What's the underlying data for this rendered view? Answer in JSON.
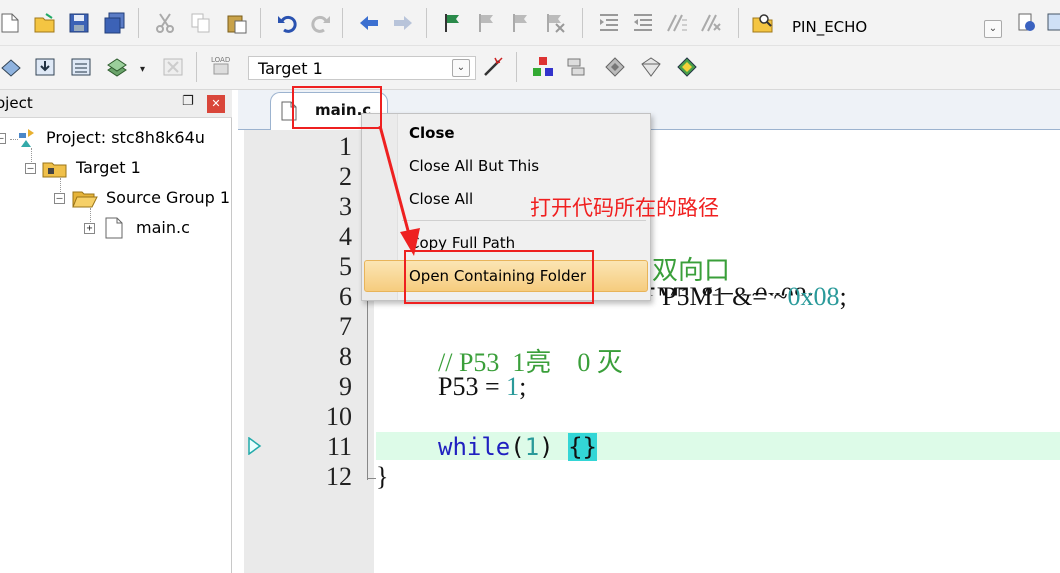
{
  "toolbar1": {
    "config_name": "PIN_ECHO"
  },
  "toolbar2": {
    "target_name": "Target 1"
  },
  "project_panel": {
    "title": "oject",
    "pin_glyph": "❐",
    "close_glyph": "✕",
    "tree": {
      "project": "Project: stc8h8k64u",
      "target": "Target 1",
      "group": "Source Group 1",
      "file": "main.c"
    }
  },
  "editor": {
    "tab_label": "main.c",
    "line_numbers": [
      "1",
      "2",
      "3",
      "4",
      "5",
      "6",
      "7",
      "8",
      "9",
      "10",
      "11",
      "12"
    ],
    "code": {
      "line5_tail": "双向口",
      "line6_visible": "P5M0 &= ~0x08; P5M1 &= ~0x08;",
      "line6_p5m1": "P5M1 &= ",
      "line6_tilde": "~",
      "line6_hex": "0x08",
      "line6_semi": ";",
      "line8_comment": "// P53  1亮    0 灭",
      "line9_lhs": "P53 = ",
      "line9_val": "1",
      "line9_semi": ";",
      "line11_kw": "while",
      "line11_open": "(",
      "line11_num": "1",
      "line11_close": ") ",
      "line11_brace": "{}",
      "line12_brace": "}"
    }
  },
  "context_menu": {
    "items": [
      {
        "label": "Close"
      },
      {
        "label": "Close All But This"
      },
      {
        "label": "Close All"
      },
      {
        "label": "Copy Full Path"
      },
      {
        "label": "Open Containing Folder"
      }
    ]
  },
  "annotation": {
    "text": "打开代码所在的路径",
    "color": "#f02020"
  },
  "colors": {
    "comment": "#3a9f3a",
    "number": "#2a9a9a",
    "keyword": "#2020c0",
    "highlight_line": "#ddfbe8"
  }
}
